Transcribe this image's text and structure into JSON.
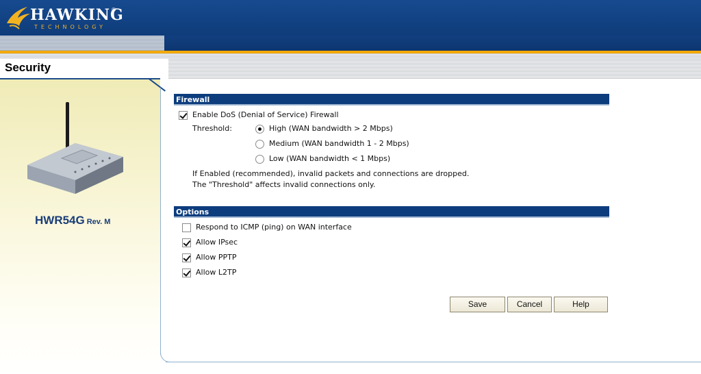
{
  "brand": {
    "name": "HAWKING",
    "tagline": "TECHNOLOGY",
    "registered": "®"
  },
  "page": {
    "title": "Security"
  },
  "device": {
    "model": "HWR54G",
    "revision": "Rev. M"
  },
  "firewall": {
    "header": "Firewall",
    "enable_label": "Enable DoS (Denial of Service) Firewall",
    "enable_checked": true,
    "threshold_label": "Threshold:",
    "options": [
      {
        "label": "High (WAN bandwidth > 2 Mbps)",
        "selected": true
      },
      {
        "label": "Medium (WAN bandwidth 1 - 2 Mbps)",
        "selected": false
      },
      {
        "label": "Low (WAN bandwidth < 1 Mbps)",
        "selected": false
      }
    ],
    "note_line1": "If Enabled (recommended), invalid packets and connections are dropped.",
    "note_line2": "The \"Threshold\" affects invalid connections only."
  },
  "options": {
    "header": "Options",
    "items": [
      {
        "label": "Respond to ICMP (ping) on WAN interface",
        "checked": false
      },
      {
        "label": "Allow IPsec",
        "checked": true
      },
      {
        "label": "Allow PPTP",
        "checked": true
      },
      {
        "label": "Allow L2TP",
        "checked": true
      }
    ]
  },
  "buttons": {
    "save": "Save",
    "cancel": "Cancel",
    "help": "Help"
  },
  "colors": {
    "header_blue": "#0f3c7a",
    "accent_gold": "#f2a900",
    "section_blue": "#0d3d7d",
    "model_text": "#1a3d78"
  }
}
